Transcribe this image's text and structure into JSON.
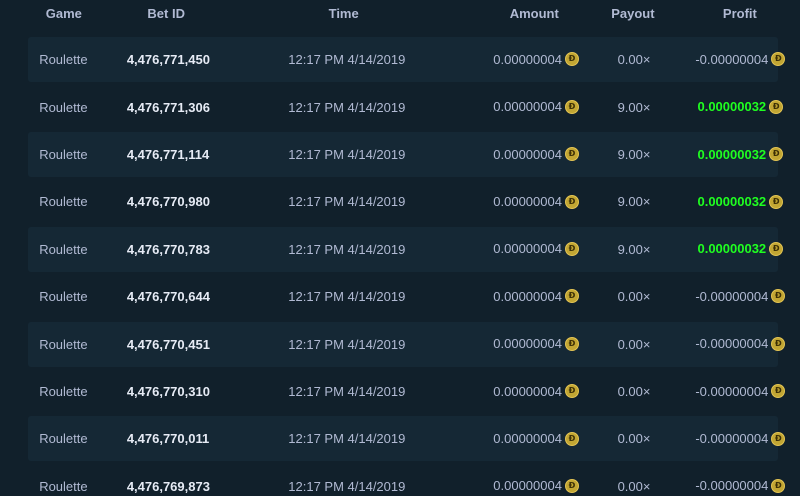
{
  "table": {
    "headers": {
      "game": "Game",
      "bet_id": "Bet ID",
      "time": "Time",
      "amount": "Amount",
      "payout": "Payout",
      "profit": "Profit"
    },
    "coin_icon": "dogecoin-icon",
    "colors": {
      "background": "#11202b",
      "row_alt": "#152835",
      "profit_positive": "#1fff20",
      "text_muted": "#b1bad3",
      "coin": "#c2a633"
    },
    "rows": [
      {
        "game": "Roulette",
        "bet_id": "4,476,771,450",
        "time": "12:17 PM 4/14/2019",
        "amount": "0.00000004",
        "payout": "0.00×",
        "profit": "-0.00000004",
        "win": false
      },
      {
        "game": "Roulette",
        "bet_id": "4,476,771,306",
        "time": "12:17 PM 4/14/2019",
        "amount": "0.00000004",
        "payout": "9.00×",
        "profit": "0.00000032",
        "win": true
      },
      {
        "game": "Roulette",
        "bet_id": "4,476,771,114",
        "time": "12:17 PM 4/14/2019",
        "amount": "0.00000004",
        "payout": "9.00×",
        "profit": "0.00000032",
        "win": true
      },
      {
        "game": "Roulette",
        "bet_id": "4,476,770,980",
        "time": "12:17 PM 4/14/2019",
        "amount": "0.00000004",
        "payout": "9.00×",
        "profit": "0.00000032",
        "win": true
      },
      {
        "game": "Roulette",
        "bet_id": "4,476,770,783",
        "time": "12:17 PM 4/14/2019",
        "amount": "0.00000004",
        "payout": "9.00×",
        "profit": "0.00000032",
        "win": true
      },
      {
        "game": "Roulette",
        "bet_id": "4,476,770,644",
        "time": "12:17 PM 4/14/2019",
        "amount": "0.00000004",
        "payout": "0.00×",
        "profit": "-0.00000004",
        "win": false
      },
      {
        "game": "Roulette",
        "bet_id": "4,476,770,451",
        "time": "12:17 PM 4/14/2019",
        "amount": "0.00000004",
        "payout": "0.00×",
        "profit": "-0.00000004",
        "win": false
      },
      {
        "game": "Roulette",
        "bet_id": "4,476,770,310",
        "time": "12:17 PM 4/14/2019",
        "amount": "0.00000004",
        "payout": "0.00×",
        "profit": "-0.00000004",
        "win": false
      },
      {
        "game": "Roulette",
        "bet_id": "4,476,770,011",
        "time": "12:17 PM 4/14/2019",
        "amount": "0.00000004",
        "payout": "0.00×",
        "profit": "-0.00000004",
        "win": false
      },
      {
        "game": "Roulette",
        "bet_id": "4,476,769,873",
        "time": "12:17 PM 4/14/2019",
        "amount": "0.00000004",
        "payout": "0.00×",
        "profit": "-0.00000004",
        "win": false
      }
    ]
  }
}
